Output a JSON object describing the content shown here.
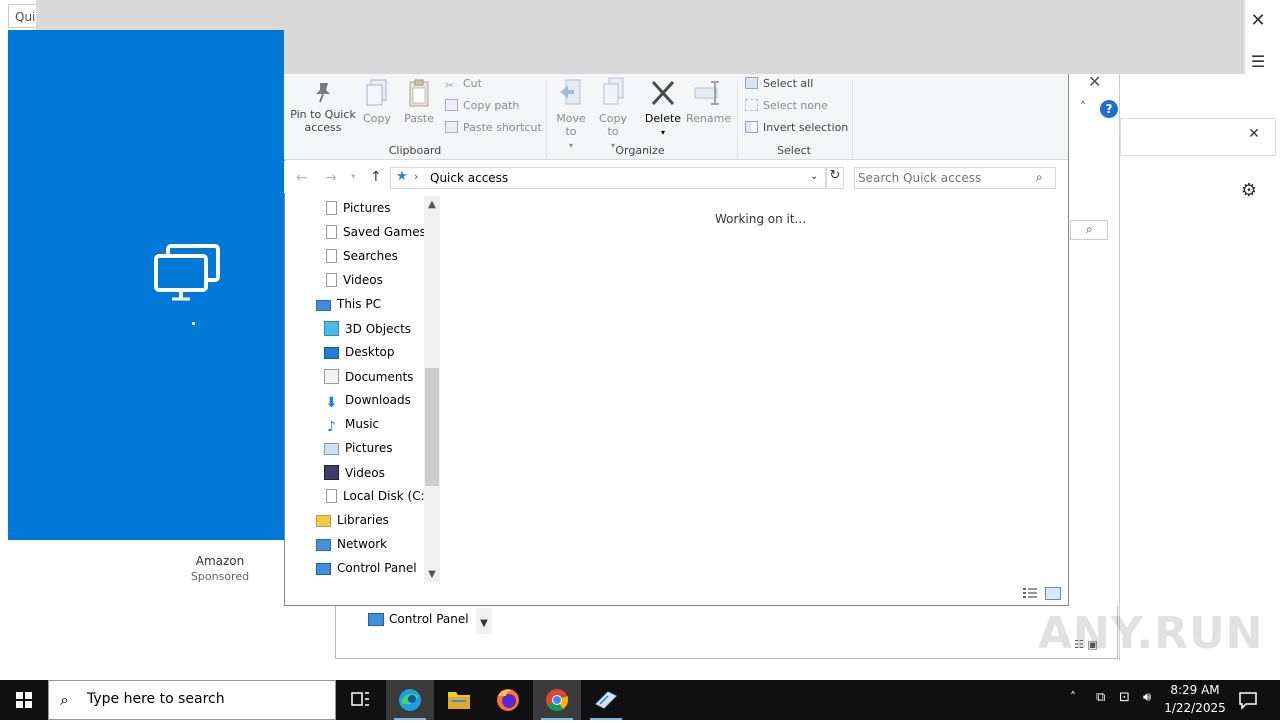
{
  "background": {
    "tab_stub": "Qui",
    "amazon_label": "Amazon",
    "amazon_sponsored": "Sponsored",
    "lower_control_panel": "Control Panel",
    "watermark": "ANY.RUN"
  },
  "ribbon": {
    "clipboard": {
      "pin_label": "Pin to Quick access",
      "copy_label": "Copy",
      "paste_label": "Paste",
      "cut_label": "Cut",
      "copy_path_label": "Copy path",
      "paste_shortcut_label": "Paste shortcut",
      "group_label": "Clipboard"
    },
    "organize": {
      "move_to_label": "Move to",
      "copy_to_label": "Copy to",
      "delete_label": "Delete",
      "rename_label": "Rename",
      "group_label": "Organize"
    },
    "select": {
      "select_all_label": "Select all",
      "select_none_label": "Select none",
      "invert_selection_label": "Invert selection",
      "group_label": "Select"
    }
  },
  "address": {
    "path": "Quick access",
    "search_placeholder": "Search Quick access"
  },
  "nav_pane": {
    "items": [
      {
        "label": "Pictures",
        "icon": "file-icon"
      },
      {
        "label": "Saved Games",
        "icon": "file-icon"
      },
      {
        "label": "Searches",
        "icon": "file-icon"
      },
      {
        "label": "Videos",
        "icon": "file-icon"
      },
      {
        "label": "This PC",
        "icon": "computer-icon"
      },
      {
        "label": "3D Objects",
        "icon": "cube-icon"
      },
      {
        "label": "Desktop",
        "icon": "desktop-icon"
      },
      {
        "label": "Documents",
        "icon": "documents-icon"
      },
      {
        "label": "Downloads",
        "icon": "download-icon"
      },
      {
        "label": "Music",
        "icon": "music-icon"
      },
      {
        "label": "Pictures",
        "icon": "pictures-icon"
      },
      {
        "label": "Videos",
        "icon": "videos-icon"
      },
      {
        "label": "Local Disk (C:)",
        "icon": "file-icon"
      },
      {
        "label": "Libraries",
        "icon": "libraries-icon"
      },
      {
        "label": "Network",
        "icon": "network-icon"
      },
      {
        "label": "Control Panel",
        "icon": "control-panel-icon"
      }
    ]
  },
  "content": {
    "status_text": "Working on it..."
  },
  "taskbar": {
    "search_text": "Type here to search",
    "time": "8:29 AM",
    "date": "1/22/2025"
  },
  "colors": {
    "accent_blue": "#0078d7",
    "taskbar": "#101010"
  }
}
